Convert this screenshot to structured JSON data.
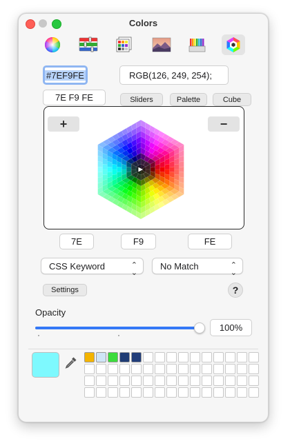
{
  "window": {
    "title": "Colors"
  },
  "toolbar": {
    "items": [
      {
        "name": "color-wheel"
      },
      {
        "name": "color-sliders"
      },
      {
        "name": "color-palettes"
      },
      {
        "name": "image-palettes"
      },
      {
        "name": "pencils"
      },
      {
        "name": "hex-color-picker"
      }
    ],
    "active_index": 5
  },
  "color": {
    "hex": "#7EF9FE",
    "rgb": "RGB(126, 249, 254);",
    "hex_spaced": "7E F9 FE",
    "r": "7E",
    "g": "F9",
    "b": "FE",
    "swatch": "#7ef9fe"
  },
  "buttons": {
    "sliders": "Sliders",
    "palette": "Palette",
    "cube": "Cube",
    "settings": "Settings",
    "plus": "+",
    "minus": "−",
    "help": "?"
  },
  "popups": {
    "format": "CSS Keyword",
    "match": "No Match"
  },
  "opacity": {
    "label": "Opacity",
    "value": "100%",
    "level": 1.0
  },
  "favorites": [
    "#f4b400",
    "#cfe5f7",
    "#3ddc3d",
    "#1f3c74",
    "#213d7a"
  ],
  "accent": "#3478f6"
}
